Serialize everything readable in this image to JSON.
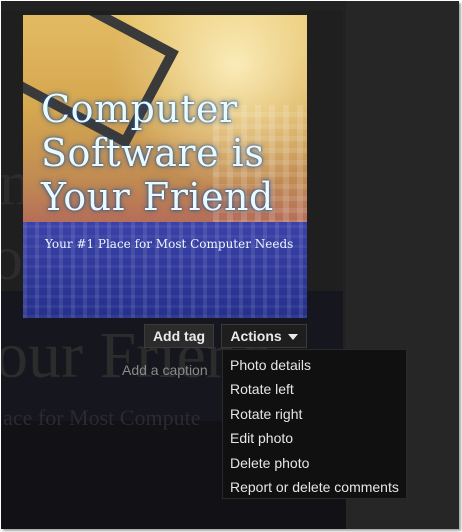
{
  "photo": {
    "title": "Computer\nSoftware is\nYour Friend",
    "subtitle": "Your #1 Place for Most Computer Needs"
  },
  "background_text": {
    "line1": "ompute",
    "line2": "oftware",
    "line3": "our Friend",
    "line4": "lace for Most Compute"
  },
  "toolbar": {
    "add_tag_label": "Add tag",
    "actions_label": "Actions",
    "caption_placeholder": "Add a caption"
  },
  "actions_menu": {
    "items": [
      {
        "label": "Photo details"
      },
      {
        "label": "Rotate left"
      },
      {
        "label": "Rotate right"
      },
      {
        "label": "Edit photo"
      },
      {
        "label": "Delete photo"
      },
      {
        "label": "Report or delete comments"
      }
    ]
  },
  "icons": {
    "actions_dropdown": "caret-down-icon"
  }
}
